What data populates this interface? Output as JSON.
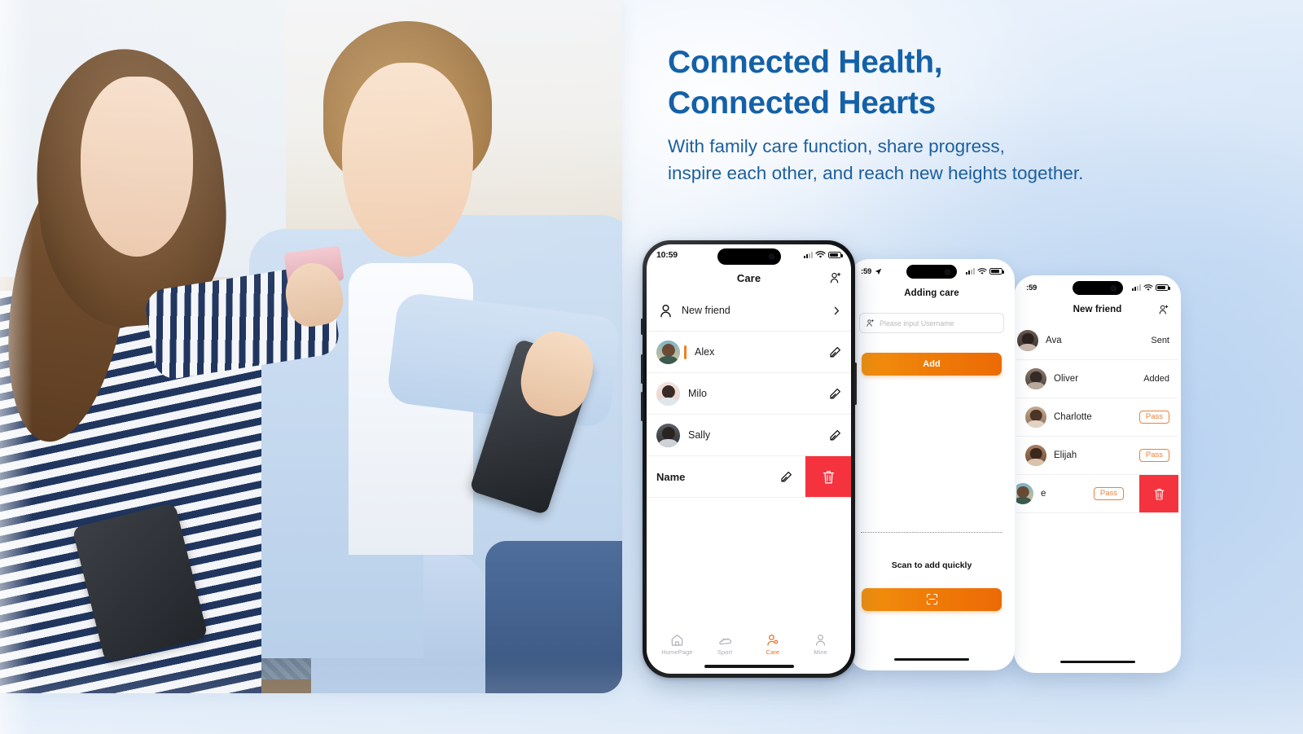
{
  "hero": {
    "headline": "Connected Health,\nConnected Hearts",
    "subcopy": "With family care function, share progress,\ninspire each other, and reach new heights together.",
    "headline_color": "#1461a8",
    "sub_color": "#1d5f9e",
    "photo_alt": "couple-on-sofa-looking-at-phone"
  },
  "colors": {
    "accent_orange": "#ef7c08",
    "delete_red": "#f5333f",
    "badge_orange": "#e8823c",
    "brand_blue": "#1461a8"
  },
  "phone1": {
    "status": {
      "time": "10:59",
      "signal": "signal-icon",
      "wifi": "wifi-icon",
      "battery": "battery-icon"
    },
    "nav": {
      "title": "Care",
      "right_icon": "add-person-icon"
    },
    "new_friend": {
      "label": "New friend",
      "left_icon": "person-icon",
      "chevron": "chevron-right-icon"
    },
    "contacts": [
      {
        "name": "Alex",
        "edit_icon": "pencil-icon",
        "accent": true
      },
      {
        "name": "Milo",
        "edit_icon": "pencil-icon",
        "accent": false
      },
      {
        "name": "Sally",
        "edit_icon": "pencil-icon",
        "accent": false
      }
    ],
    "swiped_row": {
      "name": "Name",
      "edit_icon": "pencil-icon",
      "delete_icon": "trash-icon"
    },
    "tabs": [
      {
        "label": "HomePage",
        "icon": "home-icon",
        "active": false
      },
      {
        "label": "Sport",
        "icon": "shoe-icon",
        "active": false
      },
      {
        "label": "Care",
        "icon": "care-icon",
        "active": true
      },
      {
        "label": "Mine",
        "icon": "person-icon",
        "active": false
      }
    ]
  },
  "phone2": {
    "status": {
      "time": ":59",
      "location": "location-arrow-icon",
      "signal": "signal-icon",
      "wifi": "wifi-icon",
      "battery": "battery-icon"
    },
    "nav": {
      "title": "Adding care"
    },
    "search": {
      "placeholder": "Please input Username",
      "value": "",
      "icon": "add-person-icon"
    },
    "add_button": {
      "label": "Add"
    },
    "scan_label": "Scan to add quickly",
    "scan_button": {
      "icon": "scan-icon"
    }
  },
  "phone3": {
    "status": {
      "time": ":59",
      "signal": "signal-icon",
      "wifi": "wifi-icon",
      "battery": "battery-icon"
    },
    "nav": {
      "title": "New friend",
      "right_icon": "add-person-icon"
    },
    "requests": [
      {
        "name": "Ava",
        "status": "Sent",
        "type": "text"
      },
      {
        "name": "Oliver",
        "status": "Added",
        "type": "text"
      },
      {
        "name": "Charlotte",
        "status": "Pass",
        "type": "badge"
      },
      {
        "name": "Elijah",
        "status": "Pass",
        "type": "badge"
      },
      {
        "name": "e",
        "status": "Pass",
        "type": "badge-swiped",
        "delete_icon": "trash-icon"
      }
    ]
  }
}
